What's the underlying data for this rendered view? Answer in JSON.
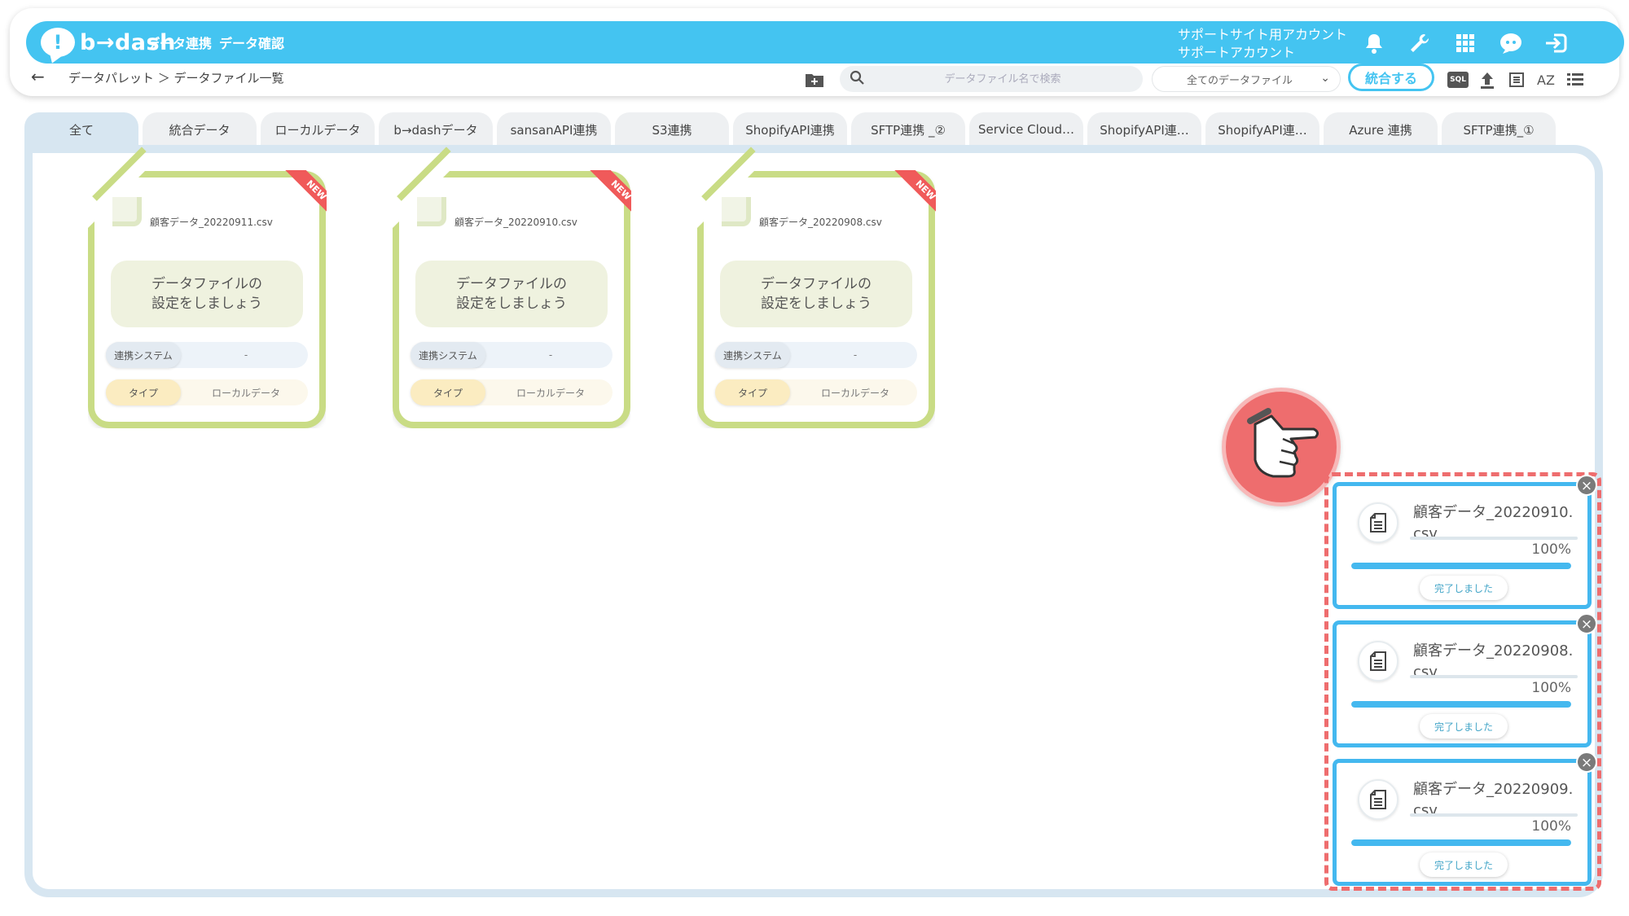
{
  "header": {
    "logo_text": "b→dash",
    "nav": [
      "データ連携",
      "データ確認"
    ],
    "account_line1": "サポートサイト用アカウント",
    "account_line2": "サポートアカウント"
  },
  "subbar": {
    "breadcrumb": "データパレット ＞ データファイル一覧",
    "search_placeholder": "データファイル名で検索",
    "filter_selected": "全てのデータファイル",
    "merge_label": "統合する",
    "sql_label": "SQL",
    "sort_label": "AZ"
  },
  "tabs": [
    {
      "label": "全て",
      "active": true
    },
    {
      "label": "統合データ"
    },
    {
      "label": "ローカルデータ"
    },
    {
      "label": "b→dashデータ"
    },
    {
      "label": "sansanAPI連携"
    },
    {
      "label": "S3連携"
    },
    {
      "label": "ShopifyAPI連携"
    },
    {
      "label": "SFTP連携 _②"
    },
    {
      "label": "Service Cloud…"
    },
    {
      "label": "ShopifyAPI連…"
    },
    {
      "label": "ShopifyAPI連…"
    },
    {
      "label": "Azure 連携"
    },
    {
      "label": "SFTP連携_①"
    }
  ],
  "cards": [
    {
      "name": "顧客データ_20220911.csv",
      "badge": "NEW",
      "message_line1": "データファイルの",
      "message_line2": "設定をしましょう",
      "system_label": "連携システム",
      "system_value": "-",
      "type_label": "タイプ",
      "type_value": "ローカルデータ"
    },
    {
      "name": "顧客データ_20220910.csv",
      "badge": "NEW",
      "message_line1": "データファイルの",
      "message_line2": "設定をしましょう",
      "system_label": "連携システム",
      "system_value": "-",
      "type_label": "タイプ",
      "type_value": "ローカルデータ"
    },
    {
      "name": "顧客データ_20220908.csv",
      "badge": "NEW",
      "message_line1": "データファイルの",
      "message_line2": "設定をしましょう",
      "system_label": "連携システム",
      "system_value": "-",
      "type_label": "タイプ",
      "type_value": "ローカルデータ"
    }
  ],
  "uploads": [
    {
      "file": "顧客データ_20220910.csv",
      "percent": "100%",
      "progress": 1.0,
      "status": "完了しました"
    },
    {
      "file": "顧客データ_20220908.csv",
      "percent": "100%",
      "progress": 1.0,
      "status": "完了しました"
    },
    {
      "file": "顧客データ_20220909.csv",
      "percent": "100%",
      "progress": 1.0,
      "status": "完了しました"
    }
  ],
  "colors": {
    "brand": "#44c4f1",
    "card_border": "#c9dc85",
    "highlight": "#ee6d6e",
    "progress": "#44b8ef"
  },
  "icons": [
    "bell-icon",
    "wrench-icon",
    "grid-icon",
    "support-chat-icon",
    "logout-icon",
    "folder-add-icon",
    "search-icon",
    "upload-icon",
    "list-view-icon",
    "sort-az-icon",
    "menu-list-icon",
    "file-icon",
    "close-icon",
    "pointing-hand-icon"
  ]
}
